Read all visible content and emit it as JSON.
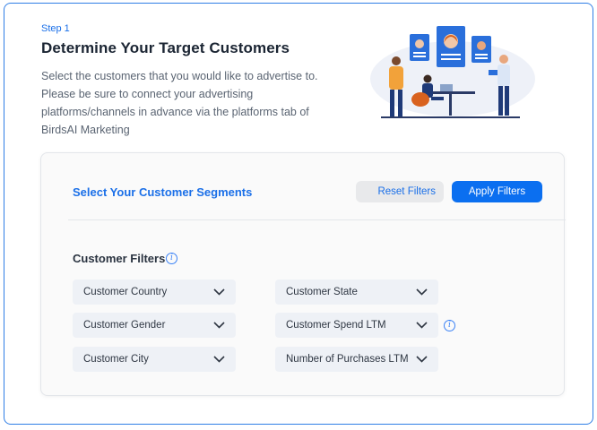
{
  "header": {
    "step": "Step 1",
    "title": "Determine Your Target Customers",
    "description": "Select the customers that you would like to advertise to. Please be sure to connect your advertising platforms/channels in advance via the platforms tab of BirdsAI Marketing"
  },
  "segments": {
    "title": "Select Your Customer Segments",
    "reset_label": "Reset Filters",
    "apply_label": "Apply Filters"
  },
  "filters": {
    "label": "Customer Filters",
    "items": [
      {
        "label": "Customer Country"
      },
      {
        "label": "Customer State"
      },
      {
        "label": "Customer Gender"
      },
      {
        "label": "Customer Spend LTM"
      },
      {
        "label": "Customer City"
      },
      {
        "label": "Number of Purchases LTM"
      }
    ]
  },
  "colors": {
    "accent": "#0b6ff0",
    "select_bg": "#eef1f6",
    "border": "#2f7ee6"
  },
  "icons": {
    "info": "info-icon",
    "chevron": "chevron-down-icon"
  }
}
